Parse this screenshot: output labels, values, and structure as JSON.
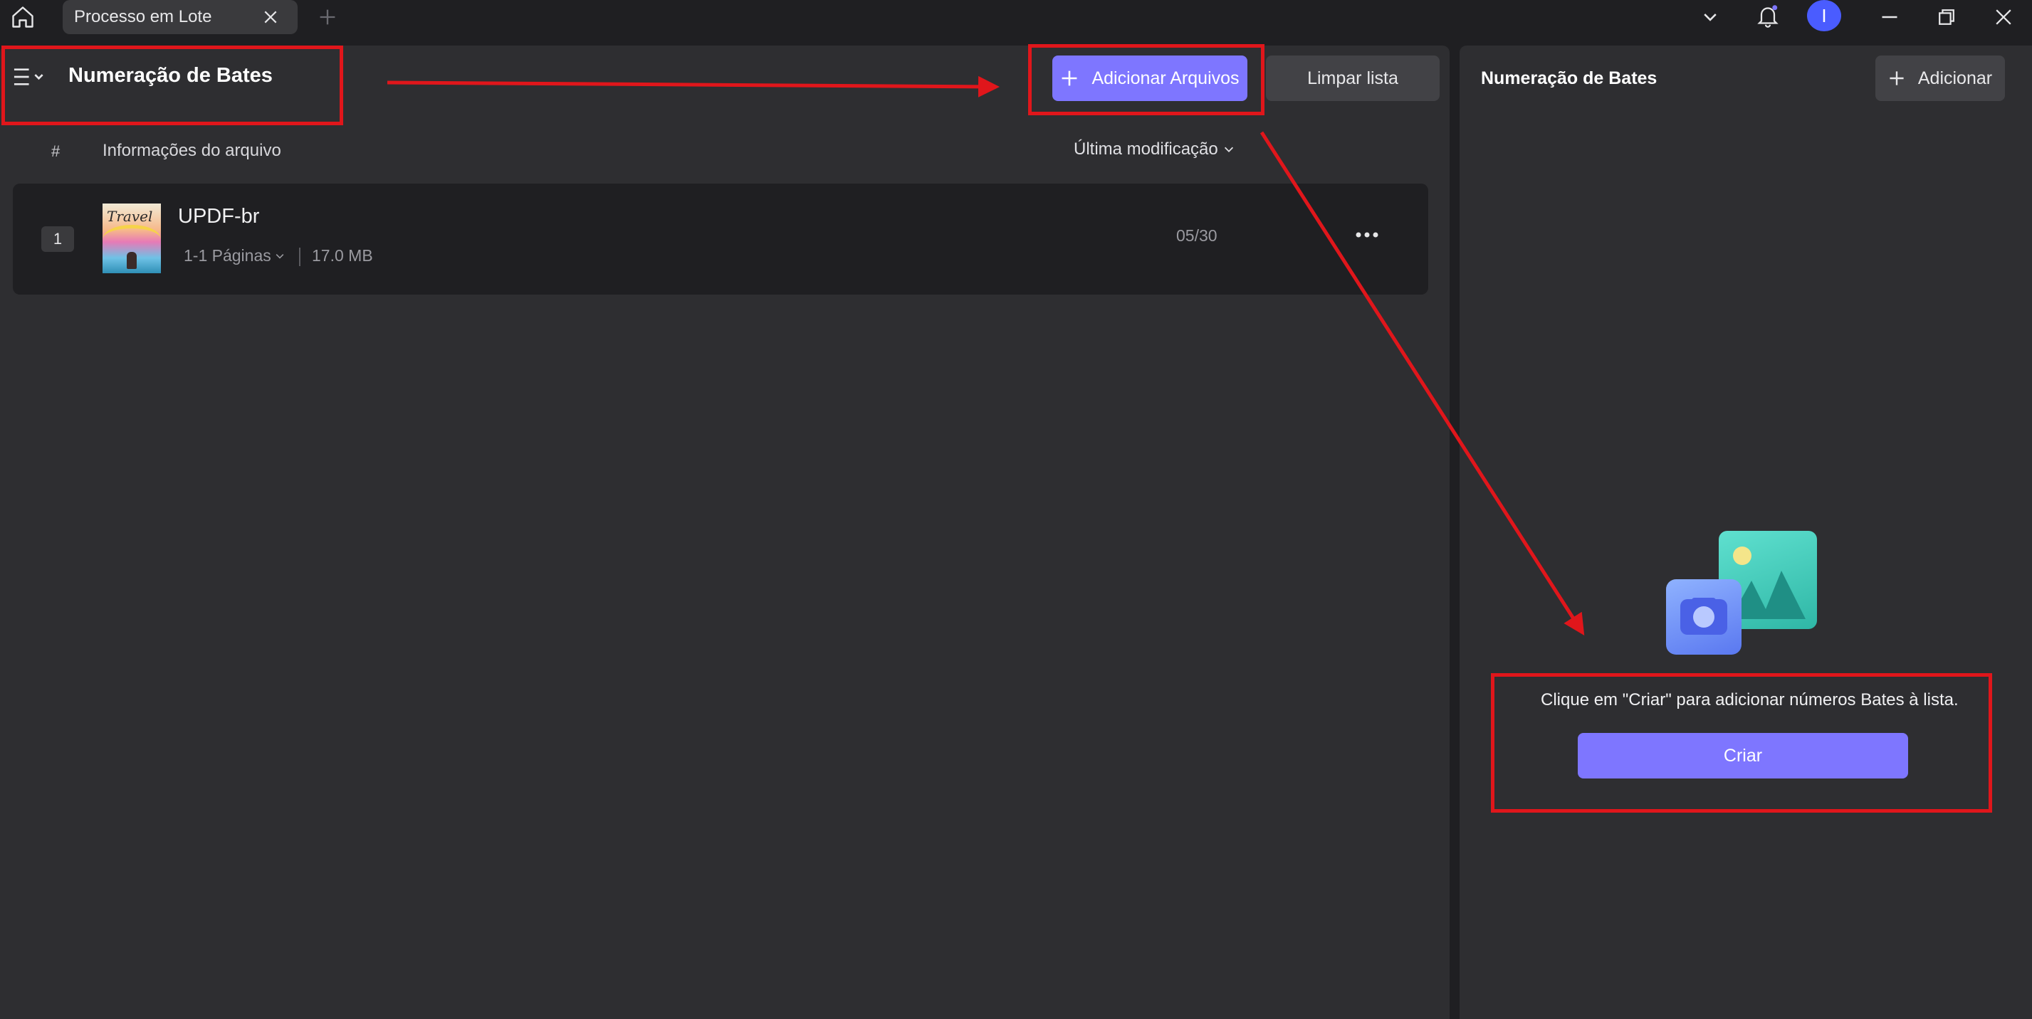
{
  "titlebar": {
    "tab_label": "Processo em Lote",
    "avatar_initial": "I",
    "accent": "#7e76ff"
  },
  "left_panel": {
    "title": "Numeração de Bates",
    "add_files_label": "Adicionar Arquivos",
    "clear_list_label": "Limpar lista",
    "columns": {
      "index": "#",
      "file_info": "Informações do arquivo",
      "sort": "Última modificação"
    },
    "files": [
      {
        "index": "1",
        "name": "UPDF-br",
        "pages": "1-1 Páginas",
        "size": "17.0 MB",
        "date": "05/30",
        "thumb_text": "Travel"
      }
    ]
  },
  "right_panel": {
    "title": "Numeração de Bates",
    "add_label": "Adicionar",
    "empty_message": "Clique em \"Criar\" para adicionar números Bates à lista.",
    "create_label": "Criar"
  },
  "colors": {
    "annotation_red": "#e0161b",
    "panel_bg": "#2e2e31",
    "app_bg": "#1f1f22"
  },
  "icons": [
    "home-icon",
    "close-icon",
    "plus-icon",
    "chevron-down-icon",
    "bell-icon",
    "minimize-icon",
    "restore-icon",
    "window-close-icon",
    "menu-icon",
    "more-icon",
    "image-illustration",
    "camera-illustration"
  ]
}
